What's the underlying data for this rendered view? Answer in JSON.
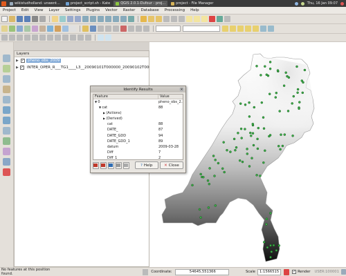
{
  "taskbar": {
    "tasks": [
      {
        "label": "wikistudholland: unwent..."
      },
      {
        "label": "project_script.sh - Kate"
      },
      {
        "label": "QGIS 2.0.1-Dufour - proj..."
      },
      {
        "label": "project - File Manager"
      }
    ],
    "clock": "Thu, 16 Jan 09:07"
  },
  "menu": [
    "Project",
    "Edit",
    "View",
    "Layer",
    "Settings",
    "Plugins",
    "Vector",
    "Raster",
    "Database",
    "Processing",
    "Help"
  ],
  "layers_panel": {
    "title": "Layers",
    "layers": [
      {
        "name": "pheno_obs_2009",
        "checked": true,
        "selected": true
      },
      {
        "name": "INTER_OPER_R___TG1____L3__20090101T000000_20090102T000...",
        "checked": true,
        "selected": false
      }
    ]
  },
  "identify": {
    "title": "Identify Results",
    "col_feature": "Feature",
    "col_value": "Value",
    "rows": [
      {
        "feature": "0",
        "value": "pheno_obs_2...",
        "indent": 0,
        "tri": "▼"
      },
      {
        "feature": "cat",
        "value": "88",
        "indent": 1,
        "tri": "▼"
      },
      {
        "feature": "(Actions)",
        "value": "",
        "indent": 2,
        "tri": "▶"
      },
      {
        "feature": "(Derived)",
        "value": "",
        "indent": 2,
        "tri": "▶"
      },
      {
        "feature": "cat",
        "value": "88",
        "indent": 3,
        "tri": ""
      },
      {
        "feature": "DATE_",
        "value": "87",
        "indent": 3,
        "tri": ""
      },
      {
        "feature": "DATE_GDD",
        "value": "94",
        "indent": 3,
        "tri": ""
      },
      {
        "feature": "DATE_GDD_1",
        "value": "89",
        "indent": 3,
        "tri": ""
      },
      {
        "feature": "datum",
        "value": "2009-03-28",
        "indent": 3,
        "tri": ""
      },
      {
        "feature": "Diff",
        "value": "7",
        "indent": 3,
        "tri": ""
      },
      {
        "feature": "Diff_1",
        "value": "2",
        "indent": 3,
        "tri": ""
      }
    ],
    "help_label": "Help",
    "close_label": "Close"
  },
  "status": {
    "message": "No features at this position found.",
    "coordinate_label": "Coordinate:",
    "coordinate_value": "54645,551366",
    "scale_label": "Scale",
    "scale_value": "1:1566515",
    "render_label": "Render",
    "crs_label": "USER:100001",
    "render_checked": true
  },
  "colors": {
    "point_fill": "#3fae4a",
    "point_stroke": "#0f5a18",
    "selected_layer": "#7fa8d6",
    "highlight": "#e0352b"
  }
}
